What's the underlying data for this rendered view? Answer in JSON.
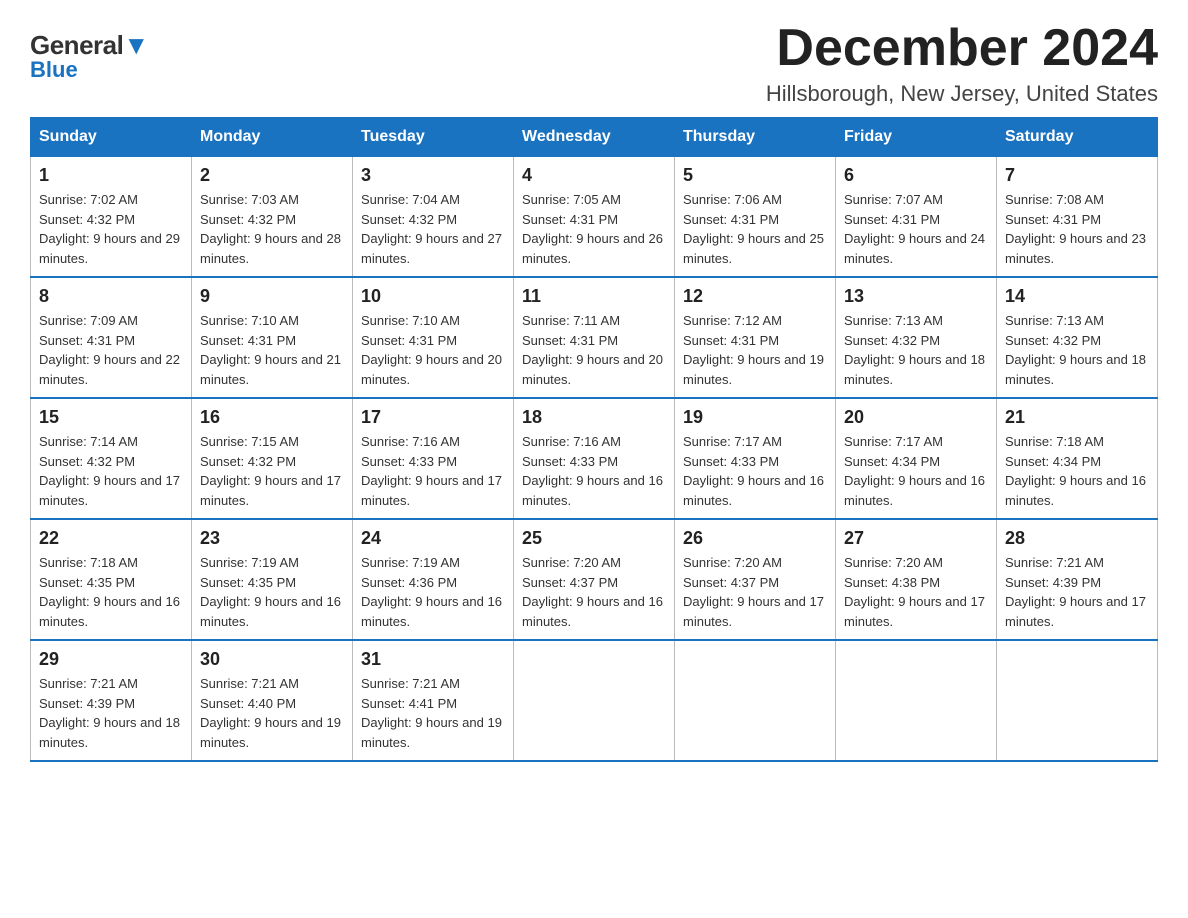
{
  "header": {
    "logo_general": "General",
    "logo_blue": "Blue",
    "title": "December 2024",
    "subtitle": "Hillsborough, New Jersey, United States"
  },
  "days_of_week": [
    "Sunday",
    "Monday",
    "Tuesday",
    "Wednesday",
    "Thursday",
    "Friday",
    "Saturday"
  ],
  "weeks": [
    [
      {
        "num": "1",
        "sunrise": "7:02 AM",
        "sunset": "4:32 PM",
        "daylight": "9 hours and 29 minutes."
      },
      {
        "num": "2",
        "sunrise": "7:03 AM",
        "sunset": "4:32 PM",
        "daylight": "9 hours and 28 minutes."
      },
      {
        "num": "3",
        "sunrise": "7:04 AM",
        "sunset": "4:32 PM",
        "daylight": "9 hours and 27 minutes."
      },
      {
        "num": "4",
        "sunrise": "7:05 AM",
        "sunset": "4:31 PM",
        "daylight": "9 hours and 26 minutes."
      },
      {
        "num": "5",
        "sunrise": "7:06 AM",
        "sunset": "4:31 PM",
        "daylight": "9 hours and 25 minutes."
      },
      {
        "num": "6",
        "sunrise": "7:07 AM",
        "sunset": "4:31 PM",
        "daylight": "9 hours and 24 minutes."
      },
      {
        "num": "7",
        "sunrise": "7:08 AM",
        "sunset": "4:31 PM",
        "daylight": "9 hours and 23 minutes."
      }
    ],
    [
      {
        "num": "8",
        "sunrise": "7:09 AM",
        "sunset": "4:31 PM",
        "daylight": "9 hours and 22 minutes."
      },
      {
        "num": "9",
        "sunrise": "7:10 AM",
        "sunset": "4:31 PM",
        "daylight": "9 hours and 21 minutes."
      },
      {
        "num": "10",
        "sunrise": "7:10 AM",
        "sunset": "4:31 PM",
        "daylight": "9 hours and 20 minutes."
      },
      {
        "num": "11",
        "sunrise": "7:11 AM",
        "sunset": "4:31 PM",
        "daylight": "9 hours and 20 minutes."
      },
      {
        "num": "12",
        "sunrise": "7:12 AM",
        "sunset": "4:31 PM",
        "daylight": "9 hours and 19 minutes."
      },
      {
        "num": "13",
        "sunrise": "7:13 AM",
        "sunset": "4:32 PM",
        "daylight": "9 hours and 18 minutes."
      },
      {
        "num": "14",
        "sunrise": "7:13 AM",
        "sunset": "4:32 PM",
        "daylight": "9 hours and 18 minutes."
      }
    ],
    [
      {
        "num": "15",
        "sunrise": "7:14 AM",
        "sunset": "4:32 PM",
        "daylight": "9 hours and 17 minutes."
      },
      {
        "num": "16",
        "sunrise": "7:15 AM",
        "sunset": "4:32 PM",
        "daylight": "9 hours and 17 minutes."
      },
      {
        "num": "17",
        "sunrise": "7:16 AM",
        "sunset": "4:33 PM",
        "daylight": "9 hours and 17 minutes."
      },
      {
        "num": "18",
        "sunrise": "7:16 AM",
        "sunset": "4:33 PM",
        "daylight": "9 hours and 16 minutes."
      },
      {
        "num": "19",
        "sunrise": "7:17 AM",
        "sunset": "4:33 PM",
        "daylight": "9 hours and 16 minutes."
      },
      {
        "num": "20",
        "sunrise": "7:17 AM",
        "sunset": "4:34 PM",
        "daylight": "9 hours and 16 minutes."
      },
      {
        "num": "21",
        "sunrise": "7:18 AM",
        "sunset": "4:34 PM",
        "daylight": "9 hours and 16 minutes."
      }
    ],
    [
      {
        "num": "22",
        "sunrise": "7:18 AM",
        "sunset": "4:35 PM",
        "daylight": "9 hours and 16 minutes."
      },
      {
        "num": "23",
        "sunrise": "7:19 AM",
        "sunset": "4:35 PM",
        "daylight": "9 hours and 16 minutes."
      },
      {
        "num": "24",
        "sunrise": "7:19 AM",
        "sunset": "4:36 PM",
        "daylight": "9 hours and 16 minutes."
      },
      {
        "num": "25",
        "sunrise": "7:20 AM",
        "sunset": "4:37 PM",
        "daylight": "9 hours and 16 minutes."
      },
      {
        "num": "26",
        "sunrise": "7:20 AM",
        "sunset": "4:37 PM",
        "daylight": "9 hours and 17 minutes."
      },
      {
        "num": "27",
        "sunrise": "7:20 AM",
        "sunset": "4:38 PM",
        "daylight": "9 hours and 17 minutes."
      },
      {
        "num": "28",
        "sunrise": "7:21 AM",
        "sunset": "4:39 PM",
        "daylight": "9 hours and 17 minutes."
      }
    ],
    [
      {
        "num": "29",
        "sunrise": "7:21 AM",
        "sunset": "4:39 PM",
        "daylight": "9 hours and 18 minutes."
      },
      {
        "num": "30",
        "sunrise": "7:21 AM",
        "sunset": "4:40 PM",
        "daylight": "9 hours and 19 minutes."
      },
      {
        "num": "31",
        "sunrise": "7:21 AM",
        "sunset": "4:41 PM",
        "daylight": "9 hours and 19 minutes."
      },
      null,
      null,
      null,
      null
    ]
  ]
}
